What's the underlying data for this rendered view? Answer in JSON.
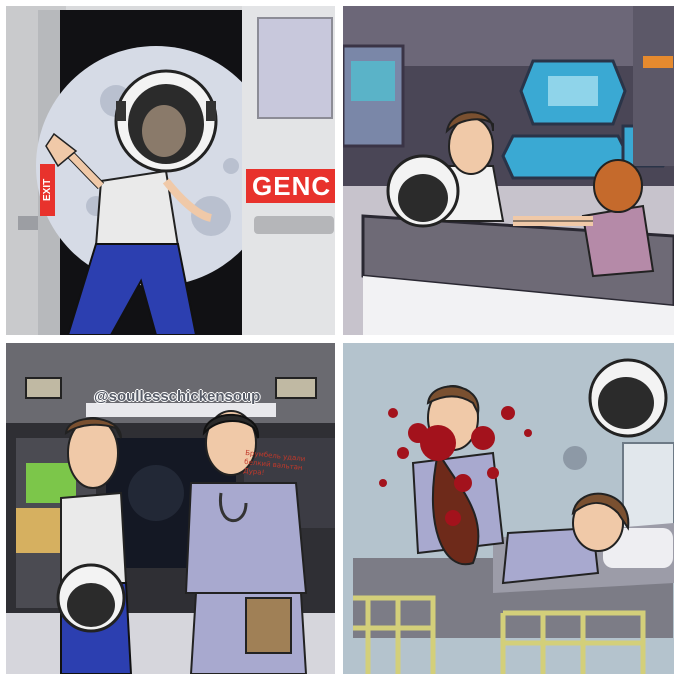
{
  "comic": {
    "panel1": {
      "door_sign": "GENC",
      "side_sign": "EXIT"
    },
    "panel2": {},
    "panel3": {
      "watermark": "@soullesschickensoup",
      "board_note": "Брумбель удали белкий вальтан Дура!"
    },
    "panel4": {}
  },
  "colors": {
    "sign_red": "#e8322c",
    "scrubs": "#a8a9cf",
    "jeans": "#2c3fb0",
    "blood": "#a3121c"
  }
}
